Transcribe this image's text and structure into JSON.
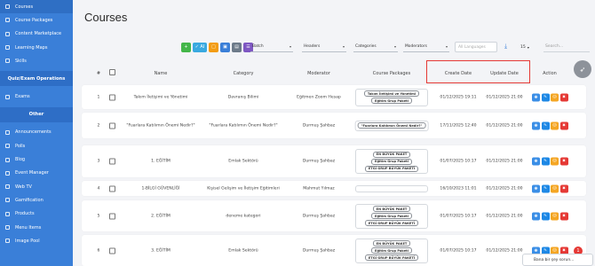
{
  "sidebar": {
    "items_top": [
      {
        "label": "Courses",
        "icon": "book-icon",
        "active": true
      },
      {
        "label": "Course Packages",
        "icon": "package-icon"
      },
      {
        "label": "Content Marketplace",
        "icon": "store-icon"
      },
      {
        "label": "Learning Maps",
        "icon": "map-icon"
      },
      {
        "label": "Skills",
        "icon": "skills-icon"
      }
    ],
    "group_quiz": "Quiz/Exam Operations",
    "items_quiz": [
      {
        "label": "Exams",
        "icon": "exam-icon"
      }
    ],
    "group_other": "Other",
    "items_other": [
      {
        "label": "Announcements",
        "icon": "megaphone-icon"
      },
      {
        "label": "Polls",
        "icon": "poll-icon"
      },
      {
        "label": "Blog",
        "icon": "blog-icon"
      },
      {
        "label": "Event Manager",
        "icon": "calendar-icon"
      },
      {
        "label": "Web TV",
        "icon": "tv-icon"
      },
      {
        "label": "Gamification",
        "icon": "trophy-icon"
      },
      {
        "label": "Products",
        "icon": "product-icon"
      },
      {
        "label": "Menu Items",
        "icon": "menu-icon"
      },
      {
        "label": "Image Pool",
        "icon": "image-icon"
      }
    ]
  },
  "page": {
    "title": "Courses"
  },
  "toolbar": {
    "buttons": [
      {
        "label": "+",
        "color": "#43b649",
        "name": "add-button"
      },
      {
        "label": "✓ AI",
        "color": "#39a9e0",
        "name": "ai-button"
      },
      {
        "label": "□",
        "color": "#f39c12",
        "name": "copy-button"
      },
      {
        "label": "▣",
        "color": "#3a7fd8",
        "name": "grid-button"
      },
      {
        "label": "▤",
        "color": "#6c7a89",
        "name": "list-button"
      },
      {
        "label": "☰",
        "color": "#7e57c2",
        "name": "menu-button"
      }
    ],
    "batch": "Batch",
    "headers": "Headers",
    "categories": "Categories",
    "moderators": "Moderators",
    "languages_placeholder": "All Languages",
    "per_page": "15",
    "search_placeholder": "Search..."
  },
  "table": {
    "headers": {
      "num": "#",
      "name": "Name",
      "category": "Category",
      "moderator": "Moderator",
      "packages": "Course Packages",
      "create": "Create Date",
      "update": "Update Date",
      "action": "Action"
    },
    "rows": [
      {
        "num": "1",
        "name": "Takım İletişimi ve Yönetimi",
        "category": "Davranış Bilimi",
        "moderator": "Eğitmen Zoom Hesap",
        "packages": [
          "Takım İletişimi ve Yönetimi",
          "Eğitim Grup Paketi"
        ],
        "create": "01/12/2025 19:11",
        "update": "01/12/2025 21:00"
      },
      {
        "num": "2",
        "name": "\"Fuarlara Katılımın Önemi Nedir?\"",
        "category": "\"Fuarlara Katılımın Önemi Nedir?\"",
        "moderator": "Durmuş Şahbaz",
        "packages": [
          "\"Fuarlara Katılımın Önemi Nedir?\""
        ],
        "create": "17/11/2025 12:40",
        "update": "01/12/2025 21:00"
      },
      {
        "num": "3",
        "name": "1. EĞİTİM",
        "category": "Emlak Sektörü",
        "moderator": "Durmuş Şahbaz",
        "packages": [
          "EN BÜYÜK PAKET",
          "Eğitim Grup Paketi",
          "ETGİ GRUP BÜYÜK PAKETİ"
        ],
        "create": "01/07/2025 10:17",
        "update": "01/12/2025 21:00"
      },
      {
        "num": "4",
        "name": "1-BİLGİ GÜVENLİĞİ",
        "category": "Kişisel Gelişim ve İletişim Eğitimleri",
        "moderator": "Mahmut Yılmaz",
        "packages": [],
        "create": "16/10/2023 11:01",
        "update": "01/12/2025 21:00"
      },
      {
        "num": "5",
        "name": "2. EĞİTİM",
        "category": "deneme kategori",
        "moderator": "Durmuş Şahbaz",
        "packages": [
          "EN BÜYÜK PAKET",
          "Eğitim Grup Paketi",
          "ETGİ GRUP BÜYÜK PAKETİ"
        ],
        "create": "01/07/2025 10:17",
        "update": "01/12/2025 21:00"
      },
      {
        "num": "6",
        "name": "3. EĞİTİM",
        "category": "Emlak Sektörü",
        "moderator": "Durmuş Şahbaz",
        "packages": [
          "EN BÜYÜK PAKET",
          "Eğitim Grup Paketi",
          "ETGİ GRUP BÜYÜK PAKETİ"
        ],
        "create": "01/07/2025 10:17",
        "update": "01/12/2025 21:00"
      }
    ],
    "action_buttons": [
      {
        "name": "view-button",
        "glyph": "◉",
        "color": "#3a8ee6"
      },
      {
        "name": "edit-button",
        "glyph": "✎",
        "color": "#1e88e5"
      },
      {
        "name": "users-button",
        "glyph": "☺",
        "color": "#f5a623"
      },
      {
        "name": "delete-button",
        "glyph": "✖",
        "color": "#e53935"
      }
    ]
  },
  "chat": {
    "label": "Bana bir şey sorun...",
    "badge": "1"
  }
}
